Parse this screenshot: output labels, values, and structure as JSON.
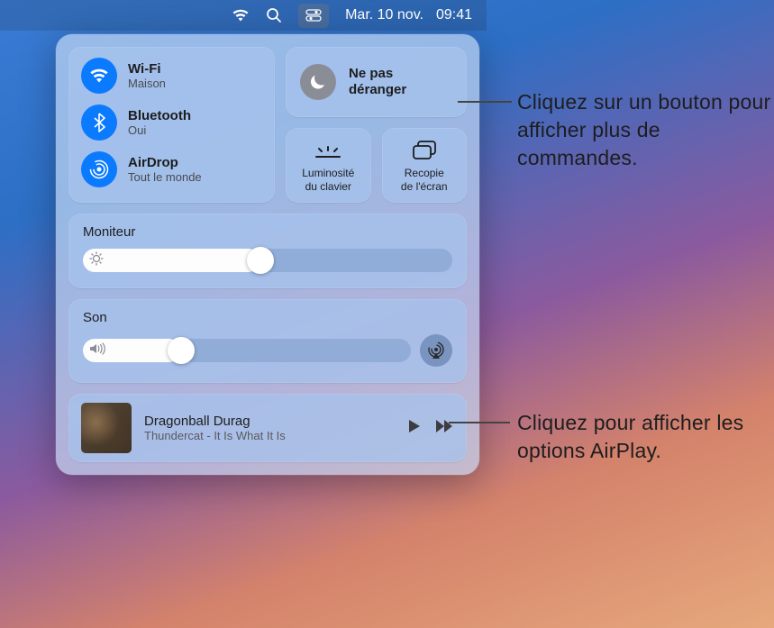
{
  "menubar": {
    "date": "Mar. 10 nov.",
    "time": "09:41"
  },
  "connectivity": {
    "wifi": {
      "label": "Wi-Fi",
      "status": "Maison"
    },
    "bluetooth": {
      "label": "Bluetooth",
      "status": "Oui"
    },
    "airdrop": {
      "label": "AirDrop",
      "status": "Tout le monde"
    }
  },
  "dnd": {
    "line1": "Ne pas",
    "line2": "déranger"
  },
  "smallTiles": {
    "keyboard": {
      "line1": "Luminosité",
      "line2": "du clavier"
    },
    "mirror": {
      "line1": "Recopie",
      "line2": "de l'écran"
    }
  },
  "display": {
    "label": "Moniteur",
    "value": 48
  },
  "sound": {
    "label": "Son",
    "value": 30
  },
  "nowplaying": {
    "title": "Dragonball Durag",
    "subtitle": "Thundercat - It Is What It Is"
  },
  "callouts": {
    "one": "Cliquez sur un bouton pour afficher plus de commandes.",
    "two": "Cliquez pour afficher les options AirPlay."
  }
}
